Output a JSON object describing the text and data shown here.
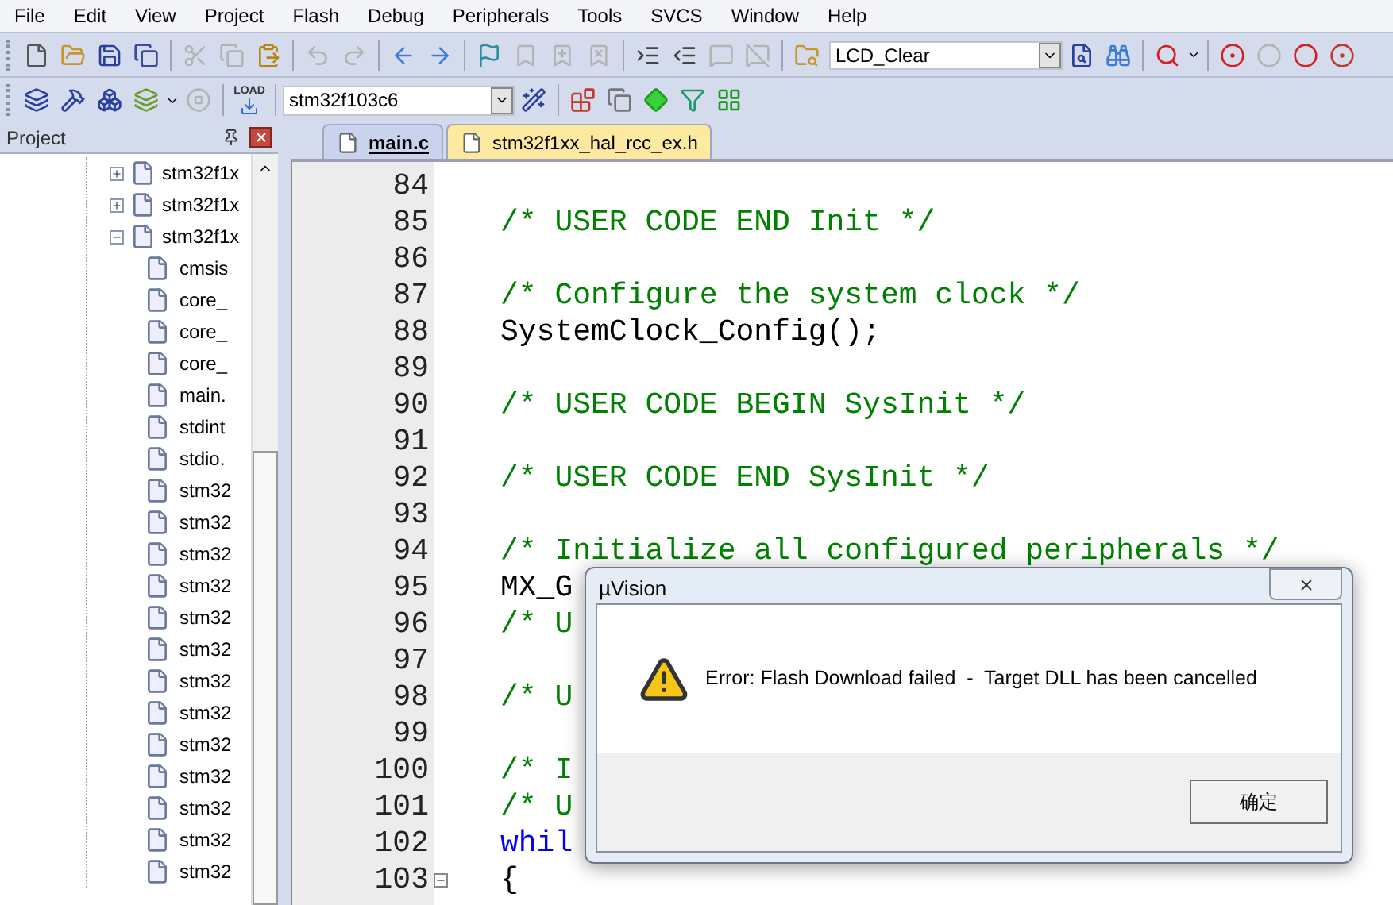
{
  "menu": [
    "File",
    "Edit",
    "View",
    "Project",
    "Flash",
    "Debug",
    "Peripherals",
    "Tools",
    "SVCS",
    "Window",
    "Help"
  ],
  "toolbar_1": {
    "buttons": [
      {
        "disabled": false
      },
      {
        "disabled": false
      },
      {
        "disabled": false
      },
      {
        "disabled": false
      },
      {
        "disabled": true
      },
      {
        "disabled": true
      },
      {
        "disabled": false
      },
      {
        "disabled": true
      },
      {
        "disabled": true
      },
      {
        "disabled": false
      },
      {
        "disabled": false
      },
      {
        "disabled": false
      },
      {
        "disabled": true
      },
      {
        "disabled": true
      },
      {
        "disabled": true
      },
      {
        "disabled": false
      },
      {
        "disabled": false
      },
      {
        "disabled": true
      },
      {
        "disabled": true
      },
      {
        "disabled": false
      }
    ],
    "find_combo": "LCD_Clear",
    "after": [
      {
        "disabled": false
      },
      {
        "disabled": false
      },
      {
        "disabled": false
      },
      {
        "disabled": false
      },
      {
        "disabled": true
      },
      {
        "disabled": false
      },
      {
        "disabled": false
      }
    ]
  },
  "toolbar_2": {
    "buttons": [
      {
        "disabled": false
      },
      {
        "disabled": false
      },
      {
        "disabled": false
      },
      {
        "disabled": false
      },
      {
        "disabled": true
      }
    ],
    "load_label": "LOAD",
    "target_combo": "stm32f103c6"
  },
  "project_panel": {
    "title": "Project",
    "tree": [
      {
        "label": "stm32f1x",
        "expanded": false
      },
      {
        "label": "stm32f1x",
        "expanded": false
      },
      {
        "label": "stm32f1x",
        "expanded": true,
        "children": [
          {
            "label": "cmsis"
          },
          {
            "label": "core_"
          },
          {
            "label": "core_"
          },
          {
            "label": "core_"
          },
          {
            "label": "main."
          },
          {
            "label": "stdint"
          },
          {
            "label": "stdio."
          },
          {
            "label": "stm32"
          },
          {
            "label": "stm32"
          },
          {
            "label": "stm32"
          },
          {
            "label": "stm32"
          },
          {
            "label": "stm32"
          },
          {
            "label": "stm32"
          },
          {
            "label": "stm32"
          },
          {
            "label": "stm32"
          },
          {
            "label": "stm32"
          },
          {
            "label": "stm32"
          },
          {
            "label": "stm32"
          },
          {
            "label": "stm32"
          },
          {
            "label": "stm32"
          }
        ]
      }
    ]
  },
  "tabs": [
    {
      "label": "main.c",
      "selected": true
    },
    {
      "label": "stm32f1xx_hal_rcc_ex.h",
      "selected": false
    }
  ],
  "editor": {
    "lines": [
      {
        "number": "84",
        "kind": "blank",
        "fold": false
      },
      {
        "number": "85",
        "kind": "comment",
        "text": "/* USER CODE END Init */",
        "fold": false
      },
      {
        "number": "86",
        "kind": "blank",
        "fold": false
      },
      {
        "number": "87",
        "kind": "comment",
        "text": "/* Configure the system clock */",
        "fold": false
      },
      {
        "number": "88",
        "kind": "code",
        "text": "SystemClock_Config();",
        "fold": false
      },
      {
        "number": "89",
        "kind": "blank",
        "fold": false
      },
      {
        "number": "90",
        "kind": "comment",
        "text": "/* USER CODE BEGIN SysInit */",
        "fold": false
      },
      {
        "number": "91",
        "kind": "blank",
        "fold": false
      },
      {
        "number": "92",
        "kind": "comment",
        "text": "/* USER CODE END SysInit */",
        "fold": false
      },
      {
        "number": "93",
        "kind": "blank",
        "fold": false
      },
      {
        "number": "94",
        "kind": "comment",
        "text": "/* Initialize all configured peripherals */",
        "fold": false
      },
      {
        "number": "95",
        "kind": "code",
        "text": "MX_G",
        "fold": false
      },
      {
        "number": "96",
        "kind": "comment",
        "text": "/* U",
        "fold": false
      },
      {
        "number": "97",
        "kind": "blank",
        "fold": false
      },
      {
        "number": "98",
        "kind": "comment",
        "text": "/* U",
        "fold": false
      },
      {
        "number": "99",
        "kind": "blank",
        "fold": false
      },
      {
        "number": "100",
        "kind": "comment",
        "text": "/* I",
        "fold": false
      },
      {
        "number": "101",
        "kind": "comment",
        "text": "/* U",
        "fold": false
      },
      {
        "number": "102",
        "kind": "keyword",
        "text": "whil",
        "fold": false
      },
      {
        "number": "103",
        "kind": "code",
        "text": "{",
        "fold": true
      }
    ]
  },
  "dialog": {
    "title": "µVision",
    "message": "Error: Flash Download failed  -  Target DLL has been cancelled",
    "button": "确定"
  }
}
